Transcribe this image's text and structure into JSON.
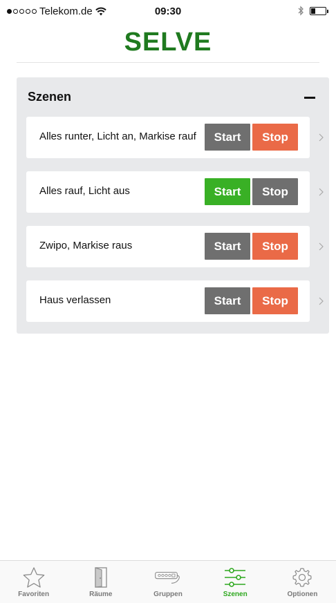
{
  "status_bar": {
    "carrier": "Telekom.de",
    "time": "09:30",
    "signal_bars_filled": 1,
    "signal_bars_total": 5
  },
  "app": {
    "logo_text": "SELVE",
    "logo_color": "#1f7a1f"
  },
  "panel": {
    "title": "Szenen",
    "collapse_icon": "minus-icon"
  },
  "scenes": [
    {
      "name": "Alles runter, Licht an, Markise rauf",
      "start_label": "Start",
      "stop_label": "Stop",
      "start_color": "#6f6f6f",
      "stop_color": "#ea6a47"
    },
    {
      "name": "Alles rauf, Licht aus",
      "start_label": "Start",
      "stop_label": "Stop",
      "start_color": "#39b025",
      "stop_color": "#6f6f6f"
    },
    {
      "name": "Zwipo, Markise raus",
      "start_label": "Start",
      "stop_label": "Stop",
      "start_color": "#6f6f6f",
      "stop_color": "#ea6a47"
    },
    {
      "name": "Haus verlassen",
      "start_label": "Start",
      "stop_label": "Stop",
      "start_color": "#6f6f6f",
      "stop_color": "#ea6a47"
    }
  ],
  "tab_bar": {
    "active_color": "#2ea81f",
    "inactive_color": "#7a7a7a",
    "tabs": [
      {
        "label": "Favoriten",
        "icon": "star-icon"
      },
      {
        "label": "Räume",
        "icon": "door-icon"
      },
      {
        "label": "Gruppen",
        "icon": "power-strip-icon"
      },
      {
        "label": "Szenen",
        "icon": "sliders-icon",
        "active": true
      },
      {
        "label": "Optionen",
        "icon": "gear-icon"
      }
    ]
  }
}
